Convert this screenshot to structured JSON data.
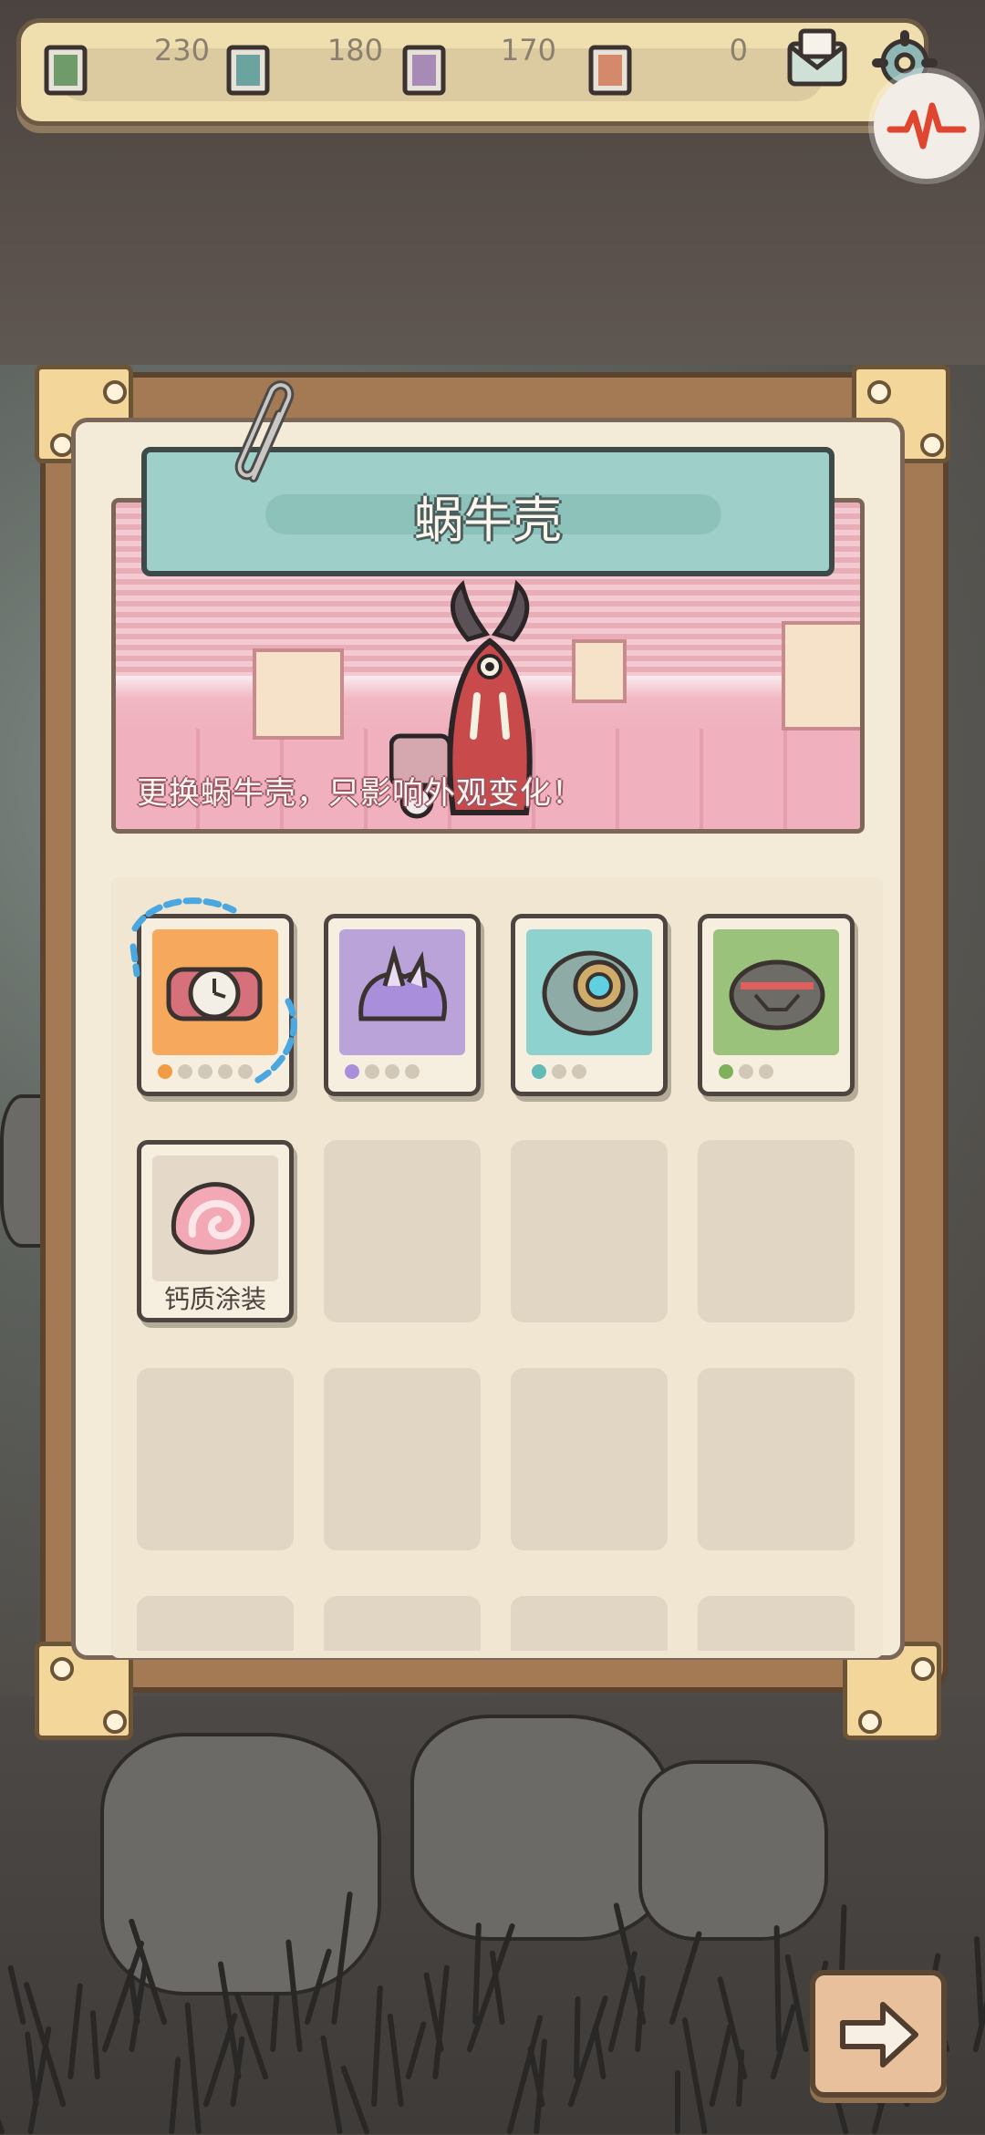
{
  "currencies": [
    {
      "name": "ticket-green",
      "value": "230",
      "color": "#6f9a6a"
    },
    {
      "name": "ticket-teal",
      "value": "180",
      "color": "#6aa3a0"
    },
    {
      "name": "ticket-purple",
      "value": "170",
      "color": "#a78bb6"
    },
    {
      "name": "ticket-orange",
      "value": "0",
      "color": "#d48a6a"
    }
  ],
  "header": {
    "mail_icon": "mail-icon",
    "settings_icon": "gear-icon",
    "pulse_icon": "heartbeat-icon"
  },
  "panel": {
    "title": "蜗牛壳",
    "description": "更换蜗牛壳，只影响外观变化！"
  },
  "shells": [
    {
      "icon": "bomb-shell-icon",
      "bg": "#f6a95c",
      "accent": "#f29b45",
      "level_dots": 5,
      "selected": true
    },
    {
      "icon": "crystal-shell-icon",
      "bg": "#b9a3d9",
      "accent": "#a98fdb",
      "level_dots": 4,
      "selected": false
    },
    {
      "icon": "armor-shell-icon",
      "bg": "#8fd1cc",
      "accent": "#5fbcb6",
      "level_dots": 3,
      "selected": false
    },
    {
      "icon": "turtle-shell-icon",
      "bg": "#9ac27a",
      "accent": "#7fb05c",
      "level_dots": 3,
      "selected": false
    },
    {
      "icon": "calcium-shell-icon",
      "bg": "#e4d8c8",
      "label": "钙质涂装"
    }
  ],
  "footer": {
    "next_icon": "arrow-right-icon"
  }
}
